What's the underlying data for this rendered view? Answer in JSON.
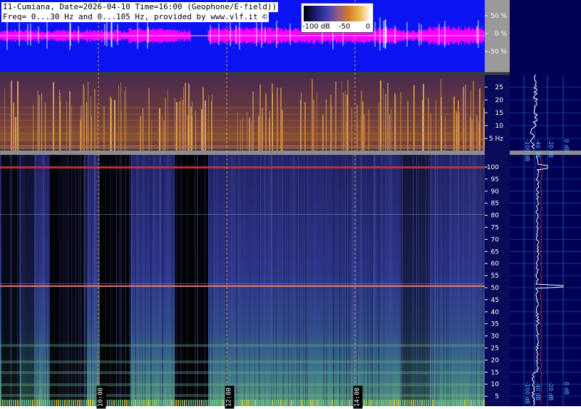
{
  "header": {
    "line1": "I1-Cumiana, Date=2026-04-10 Time=16:00 (Geophone/E-field))",
    "line2": "Freq= 0...30 Hz and 0...105 Hz, provided by www.vlf.it ©"
  },
  "colorbar": {
    "labels": [
      "-100 dB",
      "-50",
      "0"
    ],
    "stops": [
      "#000000",
      "#1a1a6e",
      "#3b3bb0",
      "#8a5a8a",
      "#d07a30",
      "#f2b84a",
      "#ffffff"
    ]
  },
  "waveform": {
    "axis_labels": [
      "50 %",
      "0 %",
      "-50 %"
    ],
    "bg_color": "#0a14f0",
    "trace_color": "#ff00ff"
  },
  "upper_spectrogram": {
    "axis_labels": [
      "25",
      "20",
      "15",
      "10",
      "5 Hz"
    ]
  },
  "lower_spectrogram": {
    "axis_labels": [
      "100",
      "95",
      "90",
      "85",
      "80",
      "75",
      "70",
      "65",
      "60",
      "55",
      "50",
      "45",
      "40",
      "35",
      "30",
      "25",
      "20",
      "15",
      "10",
      "5"
    ]
  },
  "time_markers": [
    "10:00",
    "12:00",
    "14:00"
  ],
  "spectrum_profile": {
    "top_labels": [
      "-100 dB",
      "-40 dB",
      "-20 dB",
      "0 dB"
    ],
    "bottom_labels": [
      "-100 dB",
      "-40 dB",
      "-20 dB",
      "0 dB"
    ]
  }
}
